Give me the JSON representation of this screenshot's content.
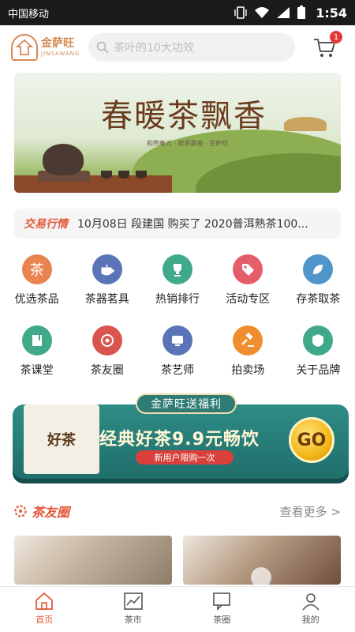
{
  "statusbar": {
    "carrier": "中国移动",
    "time": "1:54"
  },
  "header": {
    "logo_cn": "金萨旺",
    "logo_en": "JINSAWANG",
    "search_placeholder": "茶叶的10大功效",
    "cart_badge": "1"
  },
  "banner": {
    "title": "春暖茶飘香",
    "subtitle": "和煦春光 · 鲜茶飘香 · 金萨旺"
  },
  "ticker": {
    "tag": "交易行情",
    "message": "10月08日  段建国  购买了  2020普洱熟茶100..."
  },
  "grid": [
    {
      "label": "优选茶品",
      "icon": "tea-seal-icon",
      "color": "#e9834f"
    },
    {
      "label": "茶器茗具",
      "icon": "teapot-icon",
      "color": "#5b74b8"
    },
    {
      "label": "热销排行",
      "icon": "trophy-icon",
      "color": "#3fa98a"
    },
    {
      "label": "活动专区",
      "icon": "tag-icon",
      "color": "#e35d6a"
    },
    {
      "label": "存茶取茶",
      "icon": "leaf-icon",
      "color": "#4f95c9"
    },
    {
      "label": "茶课堂",
      "icon": "book-icon",
      "color": "#3fa98a"
    },
    {
      "label": "茶友圈",
      "icon": "circle-friends-icon",
      "color": "#d9534f"
    },
    {
      "label": "茶艺师",
      "icon": "tea-master-icon",
      "color": "#5b74b8"
    },
    {
      "label": "拍卖场",
      "icon": "gavel-icon",
      "color": "#ef8d2f"
    },
    {
      "label": "关于品牌",
      "icon": "brand-badge-icon",
      "color": "#3fa98a"
    }
  ],
  "promo": {
    "pill": "金萨旺送福利",
    "thumb_text": "好茶",
    "headline": "经典好茶9.9元畅饮",
    "note": "新用户限购一次",
    "go": "GO"
  },
  "section": {
    "title": "茶友圈",
    "more": "查看更多 >"
  },
  "tabs": [
    {
      "label": "首页",
      "active": true
    },
    {
      "label": "茶市",
      "active": false
    },
    {
      "label": "茶圈",
      "active": false
    },
    {
      "label": "我的",
      "active": false
    }
  ]
}
